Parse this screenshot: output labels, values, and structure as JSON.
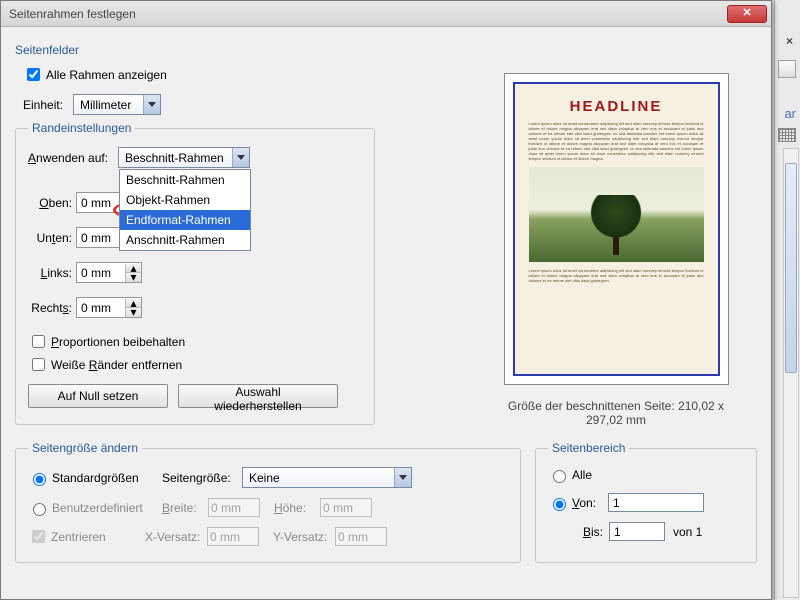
{
  "window": {
    "title": "Seitenrahmen festlegen"
  },
  "section_fields": "Seitenfelder",
  "show_all": "Alle Rahmen anzeigen",
  "unit_label": "Einheit:",
  "unit_value": "Millimeter",
  "margins": {
    "legend": "Randeinstellungen",
    "apply_label": "Anwenden auf:",
    "apply_value": "Beschnitt-Rahmen",
    "options": [
      "Beschnitt-Rahmen",
      "Objekt-Rahmen",
      "Endformat-Rahmen",
      "Anschnitt-Rahmen"
    ],
    "top_label": "Oben:",
    "top_value": "0 mm",
    "bottom_label": "Unten:",
    "bottom_value": "0 mm",
    "left_label": "Links:",
    "left_value": "0 mm",
    "right_label": "Rechts:",
    "right_value": "0 mm",
    "keep_prop": "Proportionen beibehalten",
    "white_margins": "Weiße Ränder entfernen",
    "reset_btn": "Auf Null setzen",
    "restore_btn": "Auswahl wiederherstellen"
  },
  "preview": {
    "headline": "HEADLINE",
    "caption": "Größe der beschnittenen Seite: 210,02 x 297,02 mm"
  },
  "resize": {
    "legend": "Seitengröße ändern",
    "std": "Standardgrößen",
    "custom": "Benutzerdefiniert",
    "center": "Zentrieren",
    "pagesize_label": "Seitengröße:",
    "pagesize_value": "Keine",
    "width_label": "Breite:",
    "width_value": "0 mm",
    "height_label": "Höhe:",
    "height_value": "0 mm",
    "xoff_label": "X-Versatz:",
    "xoff_value": "0 mm",
    "yoff_label": "Y-Versatz:",
    "yoff_value": "0 mm"
  },
  "range": {
    "legend": "Seitenbereich",
    "all": "Alle",
    "from": "Von:",
    "from_value": "1",
    "to": "Bis:",
    "to_value": "1",
    "of": "von 1"
  }
}
